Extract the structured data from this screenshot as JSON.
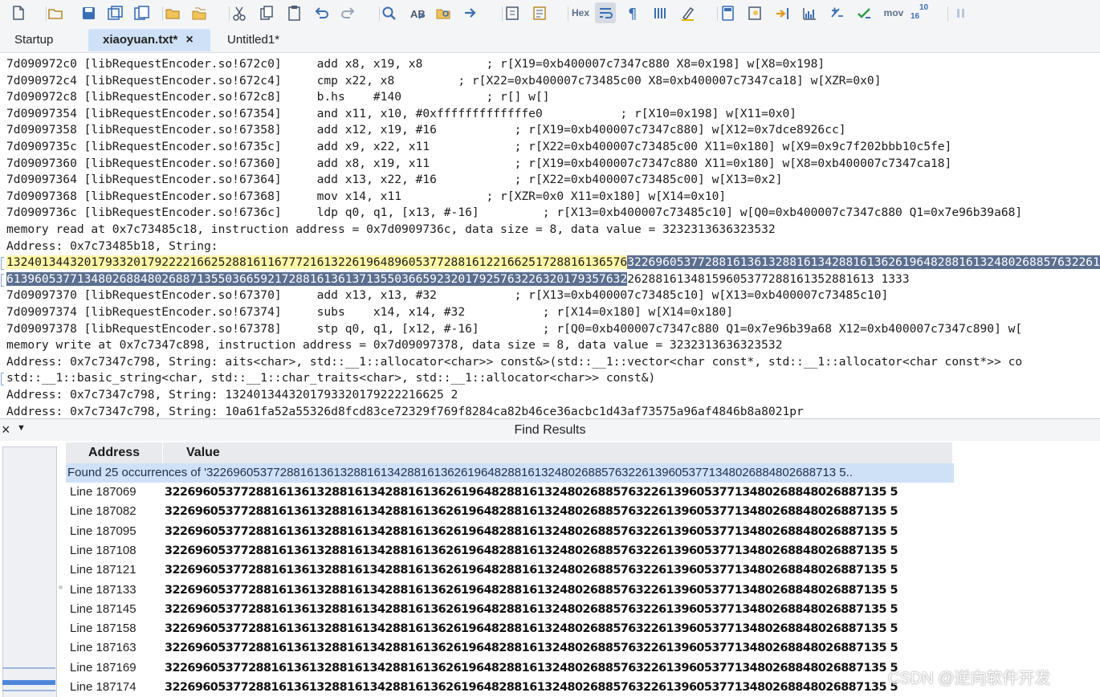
{
  "toolbar": {
    "icons": [
      "new-file-icon",
      "open-folder-icon",
      "save-icon",
      "save-all-icon",
      "save-copy-icon",
      "folder-icon",
      "folder-group-icon",
      "cut-icon",
      "copy-icon",
      "paste-icon",
      "undo-icon",
      "redo-icon",
      "find-icon",
      "replace-icon",
      "find-in-files-icon",
      "goto-icon",
      "bookmark-icon",
      "bookmark-list-icon",
      "hex-toggle",
      "wrap-icon",
      "pilcrow-icon",
      "column-mode-icon",
      "highlight-icon",
      "calculator-icon",
      "compare-icon",
      "macro-icon",
      "chart-icon",
      "math-icon",
      "checkmark-icon",
      "mov-toggle",
      "base-convert-icon",
      "pause-icon"
    ],
    "hex_label": "Hex",
    "mov_label": "mov",
    "base_label_top": "10",
    "base_label_bottom": "16"
  },
  "tabs": [
    {
      "label": "Startup",
      "active": false
    },
    {
      "label": "xiaoyuan.txt*",
      "active": true,
      "close": "×"
    },
    {
      "label": "Untitled1*",
      "active": false
    }
  ],
  "editor": {
    "lines": [
      "7d090972c0 [libRequestEncoder.so!672c0]     add x8, x19, x8         ; r[X19=0xb400007c7347c880 X8=0x198] w[X8=0x198]",
      "7d090972c4 [libRequestEncoder.so!672c4]     cmp x22, x8         ; r[X22=0xb400007c73485c00 X8=0xb400007c7347ca18] w[XZR=0x0]",
      "7d090972c8 [libRequestEncoder.so!672c8]     b.hs    #140            ; r[] w[]",
      "7d09097354 [libRequestEncoder.so!67354]     and x11, x10, #0xfffffffffffffe0           ; r[X10=0x198] w[X11=0x0]",
      "7d09097358 [libRequestEncoder.so!67358]     add x12, x19, #16           ; r[X19=0xb400007c7347c880] w[X12=0x7dce8926cc]",
      "7d0909735c [libRequestEncoder.so!6735c]     add x9, x22, x11            ; r[X22=0xb400007c73485c00 X11=0x180] w[X9=0x9c7f202bbb10c5fe]",
      "7d09097360 [libRequestEncoder.so!67360]     add x8, x19, x11            ; r[X19=0xb400007c7347c880 X11=0x180] w[X8=0xb400007c7347ca18]",
      "7d09097364 [libRequestEncoder.so!67364]     add x13, x22, #16           ; r[X22=0xb400007c73485c00] w[X13=0x2]",
      "7d09097368 [libRequestEncoder.so!67368]     mov x14, x11            ; r[XZR=0x0 X11=0x180] w[X14=0x10]",
      "7d0909736c [libRequestEncoder.so!6736c]     ldp q0, q1, [x13, #-16]         ; r[X13=0xb400007c73485c10] w[Q0=0xb400007c7347c880 Q1=0x7e96b39a68]",
      "memory read at 0x7c73485c18, instruction address = 0x7d0909736c, data size = 8, data value = 3232313636323532",
      "Address: 0x7c73485b18, String:"
    ],
    "hl_line1_yellow": "1324013443201793320179222216625288161167772161322619648960537728816122166251728816136576",
    "hl_line1_sel": "3226960537728816136132881613428816136261964828816132480268857632261396053771348026884802688713550366592172881613613713550366592320179257632263201793576",
    "hl_line2_sel": "6139605377134802688480268871355036659217288161361371355036659232017925763226320179357632",
    "hl_line2_rest": "26288161348159605377288161352881613 1333",
    "lines2": [
      "7d09097370 [libRequestEncoder.so!67370]     add x13, x13, #32           ; r[X13=0xb400007c73485c10] w[X13=0xb400007c73485c10]",
      "7d09097374 [libRequestEncoder.so!67374]     subs    x14, x14, #32           ; r[X14=0x180] w[X14=0x180]",
      "7d09097378 [libRequestEncoder.so!67378]     stp q0, q1, [x12, #-16]         ; r[Q0=0xb400007c7347c880 Q1=0x7e96b39a68 X12=0xb400007c7347c890] w[",
      "memory write at 0x7c7347c898, instruction address = 0x7d09097378, data size = 8, data value = 3232313636323532",
      "Address: 0x7c7347c798, String: aits<char>, std::__1::allocator<char>> const&>(std::__1::vector<char const*, std::__1::allocator<char const*>> co",
      "std::__1::basic_string<char, std::__1::char_traits<char>, std::__1::allocator<char>> const&)",
      "Address: 0x7c7347c798, String: 1324013443201793320179222216625 2",
      "Address: 0x7c7347c798, String: 10a61fa52a55326d8fcd83ce72329f769f8284ca82b46ce36acbc1d43af73575a96af4846b8a8021pr"
    ]
  },
  "find": {
    "title": "Find Results",
    "close": "×",
    "menu": "▼",
    "col_address": "Address",
    "col_value": "Value",
    "found": "Found 25 occurrences of '3226960537728816136132881613428816136261964828816132480268857632261396053771348026884802688713 5..",
    "rows": [
      {
        "line": "Line 187069"
      },
      {
        "line": "Line 187082"
      },
      {
        "line": "Line 187095"
      },
      {
        "line": "Line 187108"
      },
      {
        "line": "Line 187121"
      },
      {
        "line": "Line 187133"
      },
      {
        "line": "Line 187145"
      },
      {
        "line": "Line 187158"
      },
      {
        "line": "Line 187163"
      },
      {
        "line": "Line 187169"
      },
      {
        "line": "Line 187174"
      }
    ],
    "value_text": "32269605377288161361328816134288161362619648288161324802688576322613960537713480268848026887135 5"
  },
  "watermark": "CSDN @逆向软件开发"
}
